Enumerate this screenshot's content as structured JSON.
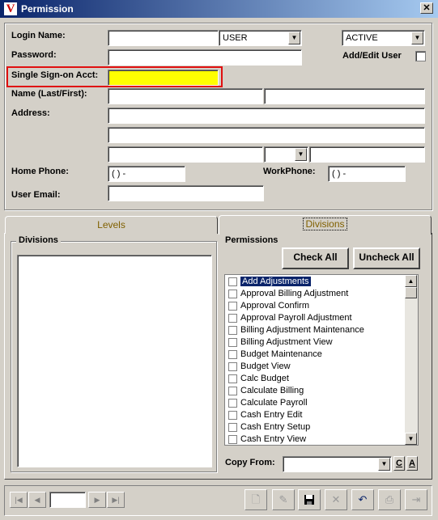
{
  "window": {
    "title": "Permission",
    "logo": "V",
    "close": "✕"
  },
  "form": {
    "login_name_label": "Login Name:",
    "login_name_value": "",
    "user_type": "USER",
    "status": "ACTIVE",
    "password_label": "Password:",
    "add_edit_user_label": "Add/Edit User",
    "sso_label": "Single Sign-on Acct:",
    "name_label": "Name (Last/First):",
    "address_label": "Address:",
    "home_phone_label": "Home Phone:",
    "home_phone_value": "(   )    -",
    "work_phone_label": "WorkPhone:",
    "work_phone_value": "(   )    -",
    "email_label": "User Email:"
  },
  "tabs": [
    {
      "label": "Levels"
    },
    {
      "label": "Divisions"
    }
  ],
  "divisions_label": "Divisions",
  "permissions": {
    "label": "Permissions",
    "check_all": "Check All",
    "uncheck_all": "Uncheck All",
    "items": [
      "Add Adjustments",
      "Approval Billing Adjustment",
      "Approval Confirm",
      "Approval Payroll Adjustment",
      "Billing Adjustment Maintenance",
      "Billing Adjustment View",
      "Budget Maintenance",
      "Budget View",
      "Calc Budget",
      "Calculate Billing",
      "Calculate Payroll",
      "Cash Entry Edit",
      "Cash Entry Setup",
      "Cash Entry View"
    ],
    "copy_from_label": "Copy From:",
    "copy_c": "C",
    "copy_a": "A"
  },
  "colors": {
    "highlight": "#ffff00",
    "selection": "#0a246a",
    "sso_border": "#e01010"
  }
}
